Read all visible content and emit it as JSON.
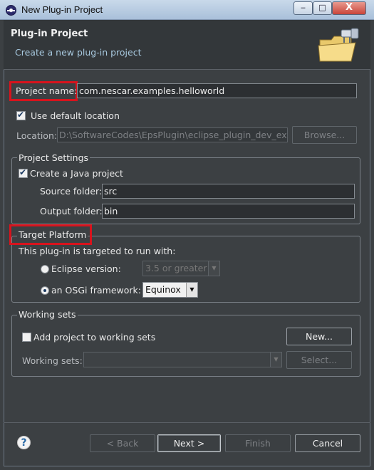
{
  "window": {
    "title": "New Plug-in Project",
    "minimize": "‒",
    "maximize": "□",
    "close": "X"
  },
  "header": {
    "title": "Plug-in Project",
    "description": "Create a new plug-in project"
  },
  "project": {
    "name_label": "Project name:",
    "name_value": "com.nescar.examples.helloworld"
  },
  "location": {
    "use_default_label": "Use default location",
    "use_default_checked": true,
    "location_label": "Location:",
    "location_value": "D:\\SoftwareCodes\\EpsPlugin\\eclipse_plugin_dev_examp",
    "browse_label": "Browse..."
  },
  "project_settings": {
    "title": "Project Settings",
    "create_java_label": "Create a Java project",
    "create_java_checked": true,
    "source_label": "Source folder:",
    "source_value": "src",
    "output_label": "Output folder:",
    "output_value": "bin"
  },
  "target_platform": {
    "title": "Target Platform",
    "intro": "This plug-in is targeted to run with:",
    "eclipse_label": "Eclipse version:",
    "eclipse_value": "3.5 or greater",
    "osgi_label": "an OSGi framework:",
    "osgi_value": "Equinox"
  },
  "working_sets": {
    "title": "Working sets",
    "add_label": "Add project to working sets",
    "new_label": "New...",
    "sets_label": "Working sets:",
    "sets_value": "",
    "select_label": "Select..."
  },
  "footer": {
    "help": "?",
    "back": "< Back",
    "next": "Next >",
    "finish": "Finish",
    "cancel": "Cancel"
  },
  "colors": {
    "highlight_box": "#d8131d",
    "background": "#3c4043",
    "header_text": "#a7c8de"
  }
}
